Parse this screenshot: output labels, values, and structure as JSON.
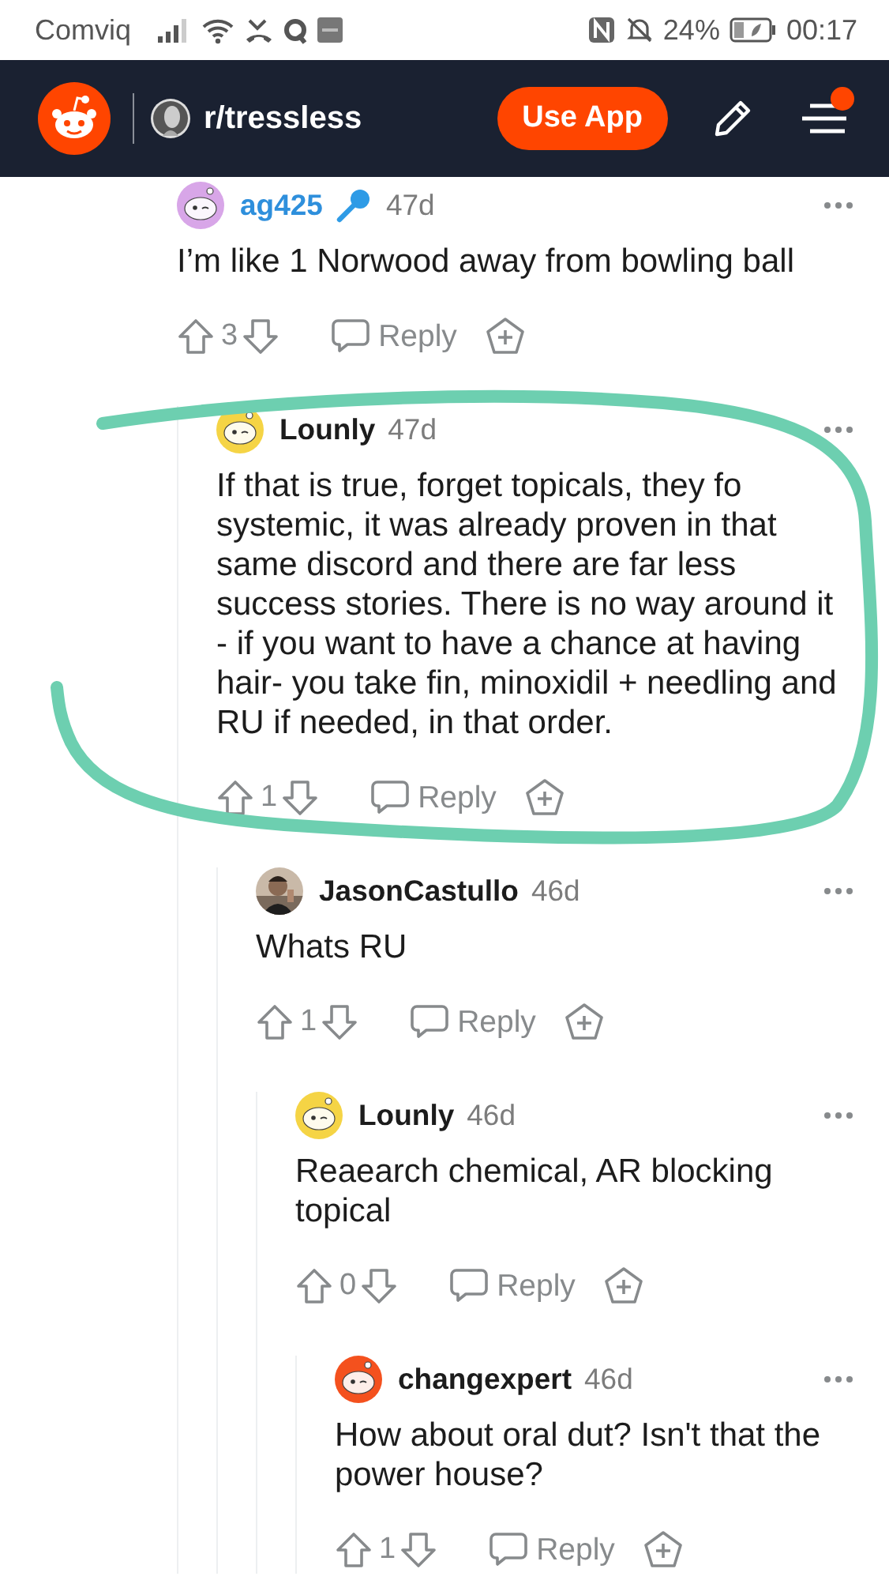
{
  "status_bar": {
    "carrier": "Comviq",
    "battery": "24%",
    "time": "00:17"
  },
  "header": {
    "community": "r/tressless",
    "use_app_button": "Use App",
    "menu_badge": true
  },
  "comments": [
    {
      "author": "ag425",
      "author_highlighted": true,
      "voice_badge": true,
      "avatar": {
        "kind": "snoo",
        "color": "#d8a6e8"
      },
      "age": "47d",
      "body": "I’m like 1 Norwood away from bowling ball",
      "votes": "3",
      "reply": "Reply",
      "children": [
        {
          "author": "Lounly",
          "author_highlighted": false,
          "voice_badge": false,
          "avatar": {
            "kind": "snoo",
            "color": "#f5d445"
          },
          "age": "47d",
          "body": "If that is true, forget topicals, they fo systemic, it was already proven in that same discord and there are far less success stories. There is no way around it - if you want to have a chance at having hair- you take fin, minoxidil + needling and RU if needed, in that order.",
          "votes": "1",
          "reply": "Reply",
          "children": [
            {
              "author": "JasonCastullo",
              "author_highlighted": false,
              "voice_badge": false,
              "age": "46d",
              "body": "Whats RU",
              "votes": "1",
              "reply": "Reply",
              "children": [
                {
                  "author": "Lounly",
                  "author_highlighted": false,
                  "voice_badge": false,
                  "avatar": {
                    "kind": "snoo",
                    "color": "#f5d445"
                  },
                  "age": "46d",
                  "body": "Reaearch chemical, AR blocking topical",
                  "votes": "0",
                  "reply": "Reply",
                  "children": [
                    {
                      "author": "changexpert",
                      "author_highlighted": false,
                      "voice_badge": false,
                      "avatar": {
                        "kind": "snoo",
                        "color": "#f4511e"
                      },
                      "age": "46d",
                      "body": "How about oral dut? Isn't that the power house?",
                      "votes": "1",
                      "reply": "Reply"
                    }
                  ]
                }
              ]
            }
          ]
        }
      ]
    }
  ],
  "annotation": {
    "kind": "loop"
  }
}
